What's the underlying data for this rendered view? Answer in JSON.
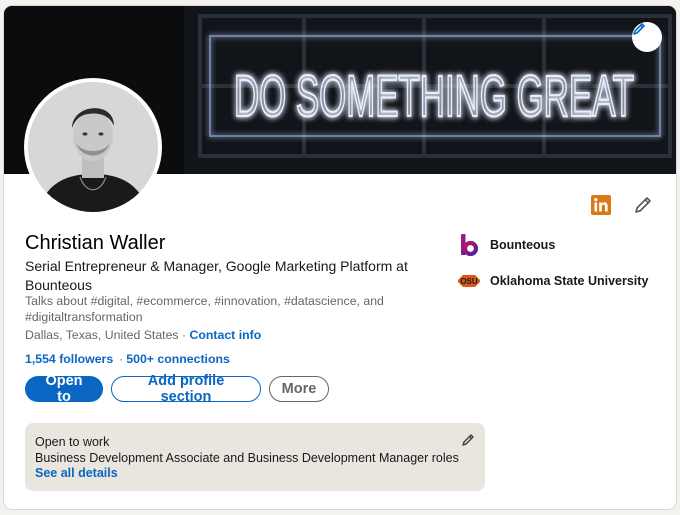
{
  "banner": {
    "neon_text": "DO SOMETHING GREAT"
  },
  "profile": {
    "name": "Christian Waller",
    "headline": "Serial Entrepreneur & Manager, Google Marketing Platform at Bounteous",
    "talks_about": "Talks about #digital, #ecommerce, #innovation, #datascience, and #digitaltransformation",
    "location": "Dallas, Texas, United States",
    "location_sep": " · ",
    "contact_link": "Contact info",
    "followers": "1,554 followers",
    "network_sep": "·",
    "connections": "500+ connections"
  },
  "actions": {
    "open_to": "Open to",
    "add_section": "Add profile section",
    "more": "More"
  },
  "open_to_work": {
    "title": "Open to work",
    "roles": "Business Development Associate and Business Development Manager roles",
    "see_all": "See all details"
  },
  "experience": [
    {
      "name": "Bounteous",
      "icon": "bounteous-logo-icon"
    },
    {
      "name": "Oklahoma State University",
      "icon": "osu-logo-icon"
    }
  ],
  "icons": {
    "linkedin": "linkedin-icon",
    "edit": "pencil-icon"
  },
  "colors": {
    "primary": "#0a66c2",
    "banner_bg": "#0b0c0e",
    "neon": "#dfe9ff",
    "otw_bg": "#e9e5df",
    "bounteous": "#6b1fb1",
    "osu": "#d85a1a",
    "linkedin": "#d97a14"
  }
}
